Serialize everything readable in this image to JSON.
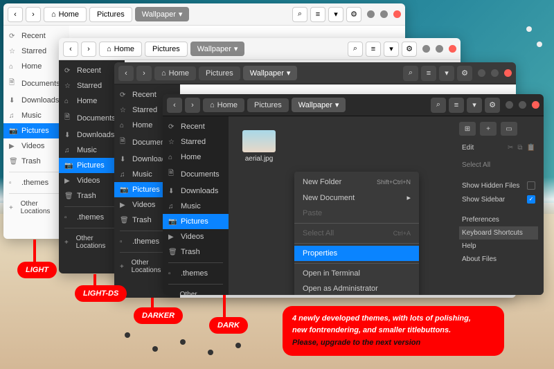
{
  "breadcrumb": {
    "home": "Home",
    "pictures": "Pictures",
    "wallpaper": "Wallpaper"
  },
  "sidebar": {
    "items": [
      {
        "icon": "⟳",
        "label": "Recent"
      },
      {
        "icon": "☆",
        "label": "Starred"
      },
      {
        "icon": "⌂",
        "label": "Home"
      },
      {
        "icon": "🗎",
        "label": "Documents"
      },
      {
        "icon": "⬇",
        "label": "Downloads"
      },
      {
        "icon": "♫",
        "label": "Music"
      },
      {
        "icon": "📷",
        "label": "Pictures"
      },
      {
        "icon": "▶",
        "label": "Videos"
      },
      {
        "icon": "🗑",
        "label": "Trash"
      },
      {
        "icon": "▫",
        "label": ".themes"
      },
      {
        "icon": "+",
        "label": "Other Locations"
      }
    ]
  },
  "file": {
    "name": "aerial.jpg"
  },
  "contextMenu": {
    "newFolder": "New Folder",
    "newFolderShortcut": "Shift+Ctrl+N",
    "newDocument": "New Document",
    "paste": "Paste",
    "selectAll": "Select All",
    "selectAllShortcut": "Ctrl+A",
    "properties": "Properties",
    "openTerminal": "Open in Terminal",
    "openAdmin": "Open as Administrator"
  },
  "rightPanel": {
    "edit": "Edit",
    "selectAll": "Select All",
    "showHidden": "Show Hidden Files",
    "showSidebar": "Show Sidebar",
    "preferences": "Preferences",
    "keyboard": "Keyboard Shortcuts",
    "help": "Help",
    "about": "About Files"
  },
  "badges": {
    "light": "LIGHT",
    "lightds": "LIGHT-DS",
    "darker": "DARKER",
    "dark": "DARK"
  },
  "banner": {
    "line1": "4 newly developed themes, with lots of polishing,",
    "line2": "new fontrendering, and smaller titlebuttons.",
    "line3": "Please, upgrade to the next version"
  }
}
